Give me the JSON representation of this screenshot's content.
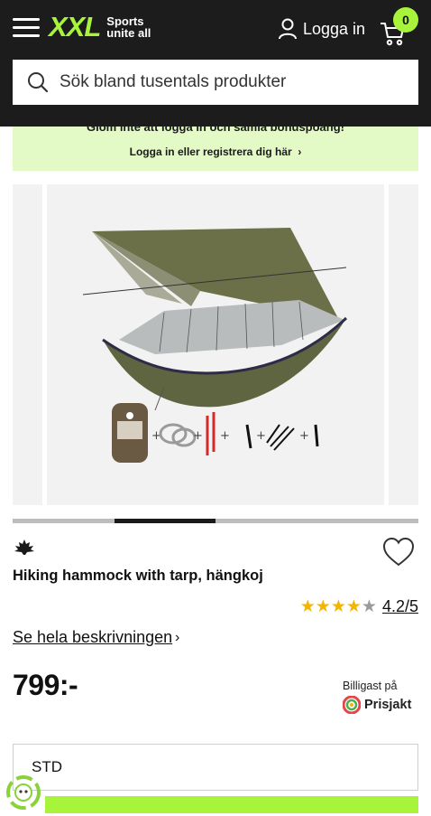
{
  "header": {
    "logo_text": "XXL",
    "logo_tag_line1": "Sports",
    "logo_tag_line2": "unite all",
    "login_label": "Logga in",
    "cart_count": "0",
    "brand_color": "#a8f43b"
  },
  "search": {
    "placeholder": "Sök bland tusentals produkter"
  },
  "banner": {
    "title": "Glöm inte att logga in och samla bonuspoäng!",
    "link": "Logga in eller registrera dig här"
  },
  "gallery": {
    "current_slide_fraction": 0.25,
    "slide_count": 4
  },
  "product": {
    "brand_name": "Mackenzie",
    "title": "Hiking hammock with tarp, hängkoj",
    "rating": 4.2,
    "rating_text": "4.2/5",
    "stars_filled": 4,
    "stars_total": 5,
    "description_link": "Se hela beskrivningen",
    "price": "799:-",
    "prisjakt_label": "Billigast på",
    "prisjakt_name": "Prisjakt",
    "variant_value": "STD"
  },
  "colors": {
    "header_bg": "#1c1c1c",
    "accent": "#a8f43b",
    "banner_bg": "#e3fac6",
    "star": "#f4b400"
  }
}
